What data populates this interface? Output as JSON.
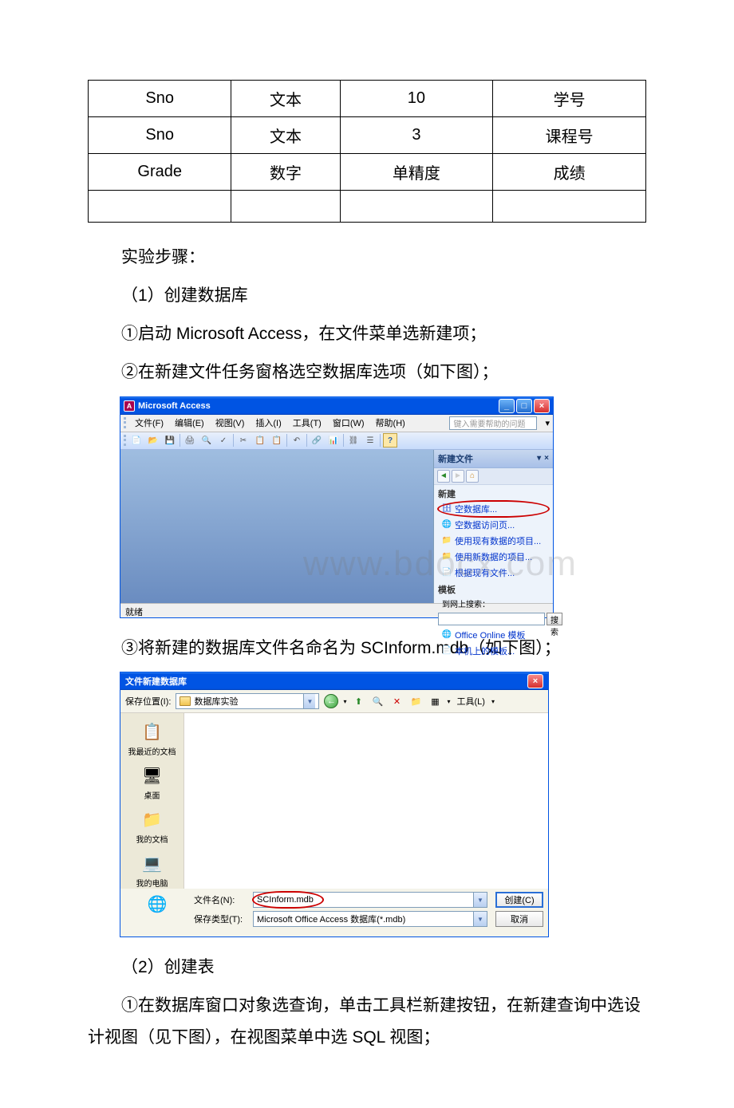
{
  "table": {
    "rows": [
      {
        "c1": "Sno",
        "c2": "文本",
        "c3": "10",
        "c4": "学号"
      },
      {
        "c1": "Sno",
        "c2": "文本",
        "c3": "3",
        "c4": "课程号"
      },
      {
        "c1": "Grade",
        "c2": "数字",
        "c3": "单精度",
        "c4": "成绩"
      },
      {
        "c1": "",
        "c2": "",
        "c3": "",
        "c4": ""
      }
    ]
  },
  "text": {
    "steps_title": "实验步骤：",
    "step1": "（1）创建数据库",
    "step1_1": "①启动 Microsoft Access，在文件菜单选新建项；",
    "step1_2": "②在新建文件任务窗格选空数据库选项（如下图）；",
    "step1_3": "③将新建的数据库文件名命名为 SCInform.mdb（如下图）；",
    "step2": "（2）创建表",
    "step2_1": "①在数据库窗口对象选查询，单击工具栏新建按钮，在新建查询中选设计视图（见下图），在视图菜单中选 SQL 视图；",
    "watermark": "www.bdocx.com"
  },
  "access": {
    "title": "Microsoft Access",
    "menu": {
      "file": "文件(F)",
      "edit": "编辑(E)",
      "view": "视图(V)",
      "insert": "插入(I)",
      "tools": "工具(T)",
      "window": "窗口(W)",
      "help": "帮助(H)"
    },
    "help_placeholder": "键入需要帮助的问题",
    "taskpane": {
      "title": "新建文件",
      "section_new": "新建",
      "links": {
        "blank_db": "空数据库...",
        "blank_page": "空数据访问页...",
        "existing_project": "使用现有数据的项目...",
        "new_project": "使用新数据的项目...",
        "from_existing": "根据现有文件...",
        "office_online": "Office Online 模板",
        "local_templates": "本机上的模板..."
      },
      "section_templates": "模板",
      "search_label": "到网上搜索：",
      "search_btn": "搜索"
    },
    "status": "就绪"
  },
  "save_dialog": {
    "title": "文件新建数据库",
    "location_label": "保存位置(I):",
    "location_value": "数据库实验",
    "tools": "工具(L)",
    "places": {
      "recent": "我最近的文档",
      "desktop": "桌面",
      "mydocs": "我的文档",
      "mycomputer": "我的电脑"
    },
    "filename_label": "文件名(N):",
    "filename_value": "SCInform.mdb",
    "savetype_label": "保存类型(T):",
    "savetype_value": "Microsoft Office Access 数据库(*.mdb)",
    "create_btn": "创建(C)",
    "cancel_btn": "取消"
  }
}
